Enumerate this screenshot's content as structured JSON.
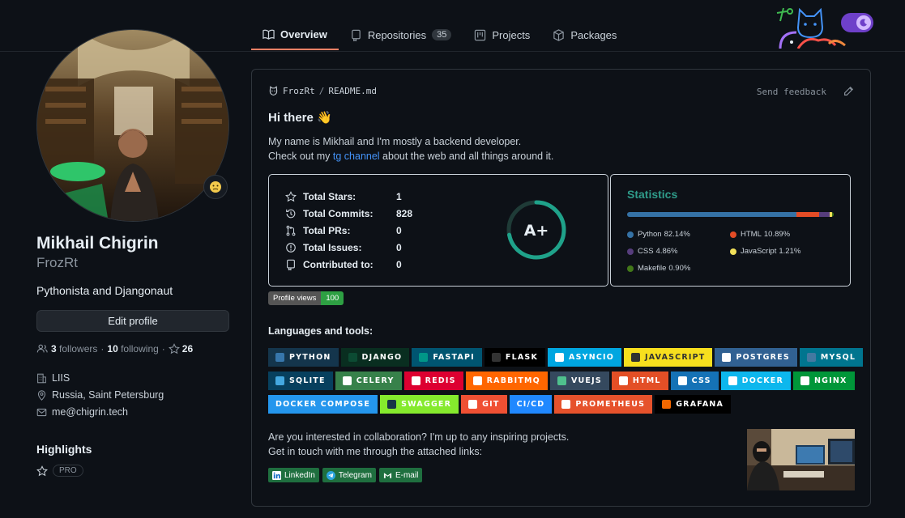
{
  "nav": {
    "tabs": [
      {
        "label": "Overview",
        "active": true
      },
      {
        "label": "Repositories",
        "count": "35"
      },
      {
        "label": "Projects"
      },
      {
        "label": "Packages"
      }
    ]
  },
  "profile": {
    "name": "Mikhail Chigrin",
    "username": "FrozRt",
    "bio": "Pythonista and Djangonaut",
    "edit_button": "Edit profile",
    "followers_count": "3",
    "followers_label": "followers",
    "following_count": "10",
    "following_label": "following",
    "stars_count": "26",
    "separator": "·",
    "company": "LIIS",
    "location": "Russia, Saint Petersburg",
    "email": "me@chigrin.tech",
    "highlights_title": "Highlights",
    "pro_label": "PRO"
  },
  "readme": {
    "path_user": "FrozRt",
    "path_sep": "/",
    "path_file": "README.md",
    "feedback": "Send feedback",
    "greeting": "Hi there 👋",
    "intro_line1": "My name is Mikhail and I'm mostly a backend developer.",
    "intro_pre": "Check out my ",
    "intro_link": "tg channel",
    "intro_post": " about the web and all things around it.",
    "stats": [
      {
        "label": "Total Stars:",
        "value": "1",
        "icon": "star-icon"
      },
      {
        "label": "Total Commits:",
        "value": "828",
        "icon": "history-icon"
      },
      {
        "label": "Total PRs:",
        "value": "0",
        "icon": "pull-request-icon"
      },
      {
        "label": "Total Issues:",
        "value": "0",
        "icon": "issue-icon"
      },
      {
        "label": "Contributed to:",
        "value": "0",
        "icon": "repo-icon"
      }
    ],
    "grade": "A+",
    "grade_progress": 0.72,
    "languages_title": "Statistics",
    "languages": [
      {
        "name": "Python",
        "percent": 82.14,
        "label": "82.14%",
        "color": "#3572A5"
      },
      {
        "name": "HTML",
        "percent": 10.89,
        "label": "10.89%",
        "color": "#e34c26"
      },
      {
        "name": "CSS",
        "percent": 4.86,
        "label": "4.86%",
        "color": "#563d7c"
      },
      {
        "name": "JavaScript",
        "percent": 1.21,
        "label": "1.21%",
        "color": "#f1e05a"
      },
      {
        "name": "Makefile",
        "percent": 0.9,
        "label": "0.90%",
        "color": "#427819"
      }
    ],
    "views_label": "Profile views",
    "views_count": "100",
    "tools_title": "Languages and tools:",
    "badges": [
      [
        {
          "label": "PYTHON",
          "bg": "#14354C",
          "ic": "#3776AB"
        },
        {
          "label": "DJANGO",
          "bg": "#092E20",
          "ic": "#0C4B33"
        },
        {
          "label": "FASTAPI",
          "bg": "#005571",
          "ic": "#009688"
        },
        {
          "label": "FLASK",
          "bg": "#000000",
          "ic": "#333333"
        },
        {
          "label": "ASYNCIO",
          "bg": "#00A6E0",
          "ic": "#ffffff"
        },
        {
          "label": "JAVASCRIPT",
          "bg": "#F7DF1E",
          "ic": "#323330",
          "dark": true
        },
        {
          "label": "POSTGRES",
          "bg": "#316192",
          "ic": "#ffffff"
        },
        {
          "label": "MYSQL",
          "bg": "#00758F",
          "ic": "#4479A1"
        }
      ],
      [
        {
          "label": "SQLITE",
          "bg": "#07405E",
          "ic": "#44A8E0",
          "light": true
        },
        {
          "label": "CELERY",
          "bg": "#37814A",
          "ic": "#ffffff"
        },
        {
          "label": "REDIS",
          "bg": "#DD0031",
          "ic": "#ffffff"
        },
        {
          "label": "RABBITMQ",
          "bg": "#FF6600",
          "ic": "#ffffff"
        },
        {
          "label": "VUEJS",
          "bg": "#35495E",
          "ic": "#4FC08D"
        },
        {
          "label": "HTML",
          "bg": "#E34F26",
          "ic": "#ffffff"
        },
        {
          "label": "CSS",
          "bg": "#1572B6",
          "ic": "#ffffff"
        },
        {
          "label": "DOCKER",
          "bg": "#0DB7ED",
          "ic": "#ffffff"
        },
        {
          "label": "NGINX",
          "bg": "#009639",
          "ic": "#ffffff"
        }
      ],
      [
        {
          "label": "DOCKER COMPOSE",
          "bg": "#2496ED",
          "ic": ""
        },
        {
          "label": "SWAGGER",
          "bg": "#85EA2D",
          "ic": "#173647"
        },
        {
          "label": "GIT",
          "bg": "#F05033",
          "ic": "#ffffff"
        },
        {
          "label": "CI/CD",
          "bg": "#2088FF",
          "ic": ""
        },
        {
          "label": "PROMETHEUS",
          "bg": "#E6522C",
          "ic": "#ffffff"
        },
        {
          "label": "GRAFANA",
          "bg": "#000000",
          "ic": "#F46800"
        }
      ]
    ],
    "collab_line1": "Are you interested in collaboration? I'm up to any inspiring projects.",
    "collab_line2": "Get in touch with me through the attached links:",
    "contacts": [
      {
        "label": "LinkedIn",
        "icon": "linkedin-icon"
      },
      {
        "label": "Telegram",
        "icon": "telegram-icon"
      },
      {
        "label": "E-mail",
        "icon": "gmail-icon"
      }
    ]
  }
}
